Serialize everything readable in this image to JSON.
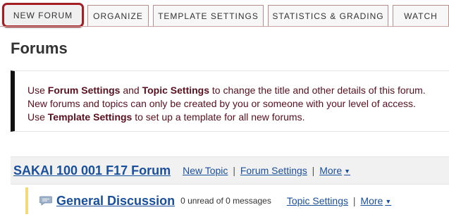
{
  "toolbar": {
    "tabs": [
      {
        "label": "NEW FORUM"
      },
      {
        "label": "ORGANIZE"
      },
      {
        "label": "TEMPLATE SETTINGS"
      },
      {
        "label": "STATISTICS & GRADING"
      },
      {
        "label": "WATCH"
      }
    ],
    "highlight_color": "#a21f24"
  },
  "page": {
    "title": "Forums"
  },
  "notice": {
    "line1": {
      "pre": "Use ",
      "b1": "Forum Settings",
      "mid": " and ",
      "b2": "Topic Settings",
      "post": " to change the title and other details of this forum."
    },
    "line2": "New forums and topics can only be created by you or someone with your level of access.",
    "line3": {
      "pre": "Use ",
      "b1": "Template Settings",
      "post": " to set up a template for all new forums."
    },
    "text_color": "#5a0f1e"
  },
  "forum": {
    "title": "SAKAI 100 001 F17 Forum",
    "actions": {
      "new_topic": "New Topic",
      "settings": "Forum Settings",
      "more": "More"
    },
    "separator": "|"
  },
  "topic": {
    "icon": "chat-bubble-icon",
    "title": "General Discussion",
    "count": "0 unread of 0 messages",
    "actions": {
      "settings": "Topic Settings",
      "more": "More"
    },
    "separator": "|"
  },
  "colors": {
    "link": "#1a4f9c",
    "topic_accent": "#f2d97d"
  }
}
